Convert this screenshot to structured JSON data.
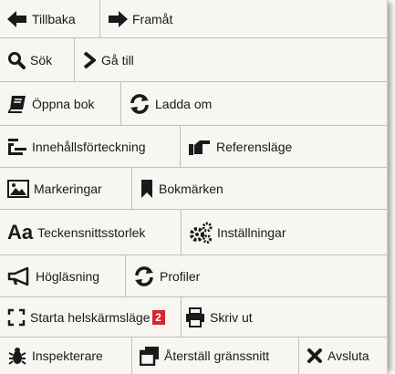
{
  "menu": {
    "back": "Tillbaka",
    "forward": "Framåt",
    "search": "Sök",
    "goto": "Gå till",
    "open_book": "Öppna bok",
    "reload": "Ladda om",
    "toc": "Innehållsförteckning",
    "reference_mode": "Referensläge",
    "highlights": "Markeringar",
    "bookmarks": "Bokmärken",
    "font_size_glyph": "Aa",
    "font_size": "Teckensnittsstorlek",
    "settings": "Inställningar",
    "read_aloud": "Högläsning",
    "profiles": "Profiler",
    "fullscreen": "Starta helskärmsläge",
    "fullscreen_badge": "2",
    "print": "Skriv ut",
    "inspector": "Inspekterare",
    "reset_interface": "Återställ gränssnitt",
    "quit": "Avsluta"
  },
  "colors": {
    "icon": "#1a1a1a",
    "badge": "#d9232d",
    "background": "#f7f6f2"
  }
}
